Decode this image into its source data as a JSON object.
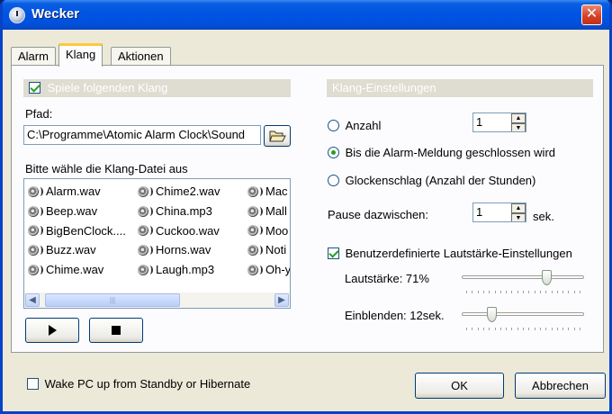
{
  "window": {
    "title": "Wecker"
  },
  "tabs": [
    {
      "label": "Alarm",
      "active": false
    },
    {
      "label": "Klang",
      "active": true
    },
    {
      "label": "Aktionen",
      "active": false
    }
  ],
  "left": {
    "play_sound_label": "Spiele folgenden Klang",
    "play_sound_checked": true,
    "path_label": "Pfad:",
    "path_value": "C:\\Programme\\Atomic Alarm Clock\\Sound",
    "choose_label": "Bitte wähle die Klang-Datei aus",
    "files": [
      [
        "Alarm.wav",
        "Beep.wav",
        "BigBenClock....",
        "Buzz.wav",
        "Chime.wav"
      ],
      [
        "Chime2.wav",
        "China.mp3",
        "Cuckoo.wav",
        "Horns.wav",
        "Laugh.mp3"
      ],
      [
        "Mac",
        "Mall",
        "Moo",
        "Noti",
        "Oh-y"
      ]
    ]
  },
  "right": {
    "group_title": "Klang-Einstellungen",
    "count_label": "Anzahl",
    "count_value": "1",
    "until_closed_label": "Bis die Alarm-Meldung geschlossen wird",
    "chime_label": "Glockenschlag (Anzahl der Stunden)",
    "selected_mode": "until_closed",
    "pause_label": "Pause dazwischen:",
    "pause_value": "1",
    "pause_unit": "sek.",
    "custom_volume_label": "Benutzerdefinierte Lautstärke-Einstellungen",
    "custom_volume_checked": true,
    "volume_label": "Lautstärke: 71%",
    "volume_value": 71,
    "fade_label": "Einblenden: 12sek.",
    "fade_fraction": 0.22
  },
  "bottom": {
    "wake_label": "Wake PC up from Standby or Hibernate",
    "wake_checked": false,
    "ok_label": "OK",
    "cancel_label": "Abbrechen"
  },
  "colors": {
    "title_bar": "#0054e3",
    "window_bg": "#ece9d8",
    "check_green": "#21a121"
  }
}
